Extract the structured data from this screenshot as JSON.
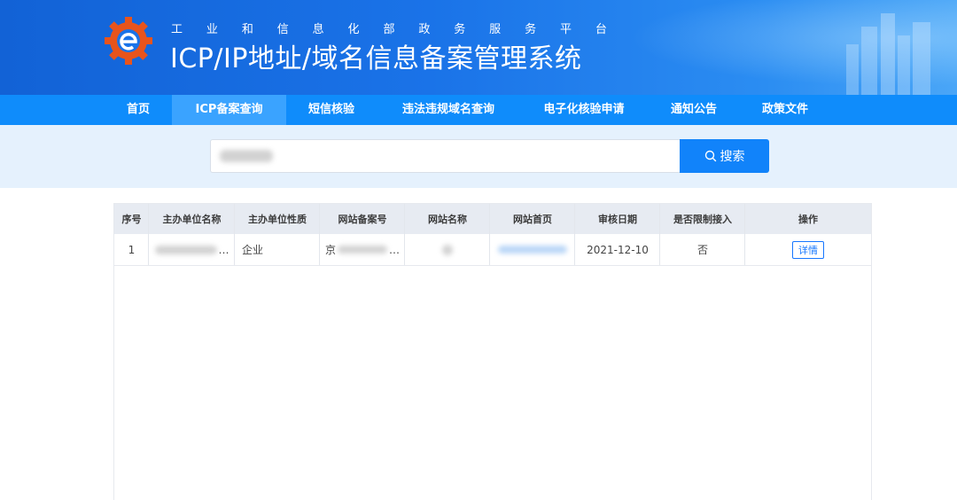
{
  "header": {
    "org_chars": [
      "工",
      "业",
      "和",
      "信",
      "息",
      "化",
      "部",
      "政",
      "务",
      "服",
      "务",
      "平",
      "台"
    ],
    "system_title": "ICP/IP地址/域名信息备案管理系统",
    "logo_icon": "gear-e-logo-icon",
    "colors": {
      "banner_start": "#1262d6",
      "banner_end": "#4aa6f7"
    }
  },
  "nav": {
    "items": [
      {
        "label": "首页"
      },
      {
        "label": "ICP备案查询"
      },
      {
        "label": "短信核验"
      },
      {
        "label": "违法违规域名查询"
      },
      {
        "label": "电子化核验申请"
      },
      {
        "label": "通知公告"
      },
      {
        "label": "政策文件"
      }
    ],
    "active_index": 1,
    "colors": {
      "bar": "#0f8cfb",
      "active": "#3aa3ff"
    }
  },
  "search": {
    "value": "",
    "button_label": "搜索",
    "button_icon": "search-icon",
    "colors": {
      "button": "#1183fa",
      "band": "#e5f1fd"
    }
  },
  "table": {
    "columns": [
      "序号",
      "主办单位名称",
      "主办单位性质",
      "网站备案号",
      "网站名称",
      "网站首页",
      "审核日期",
      "是否限制接入",
      "操作"
    ],
    "rows": [
      {
        "index": "1",
        "org_name": "",
        "org_type": "企业",
        "record_no": "京",
        "record_no_suffix": "…",
        "org_name_suffix": "…",
        "site_name": "",
        "homepage": "",
        "audit_date": "2021-12-10",
        "restricted": "否",
        "action_label": "详情"
      }
    ]
  }
}
